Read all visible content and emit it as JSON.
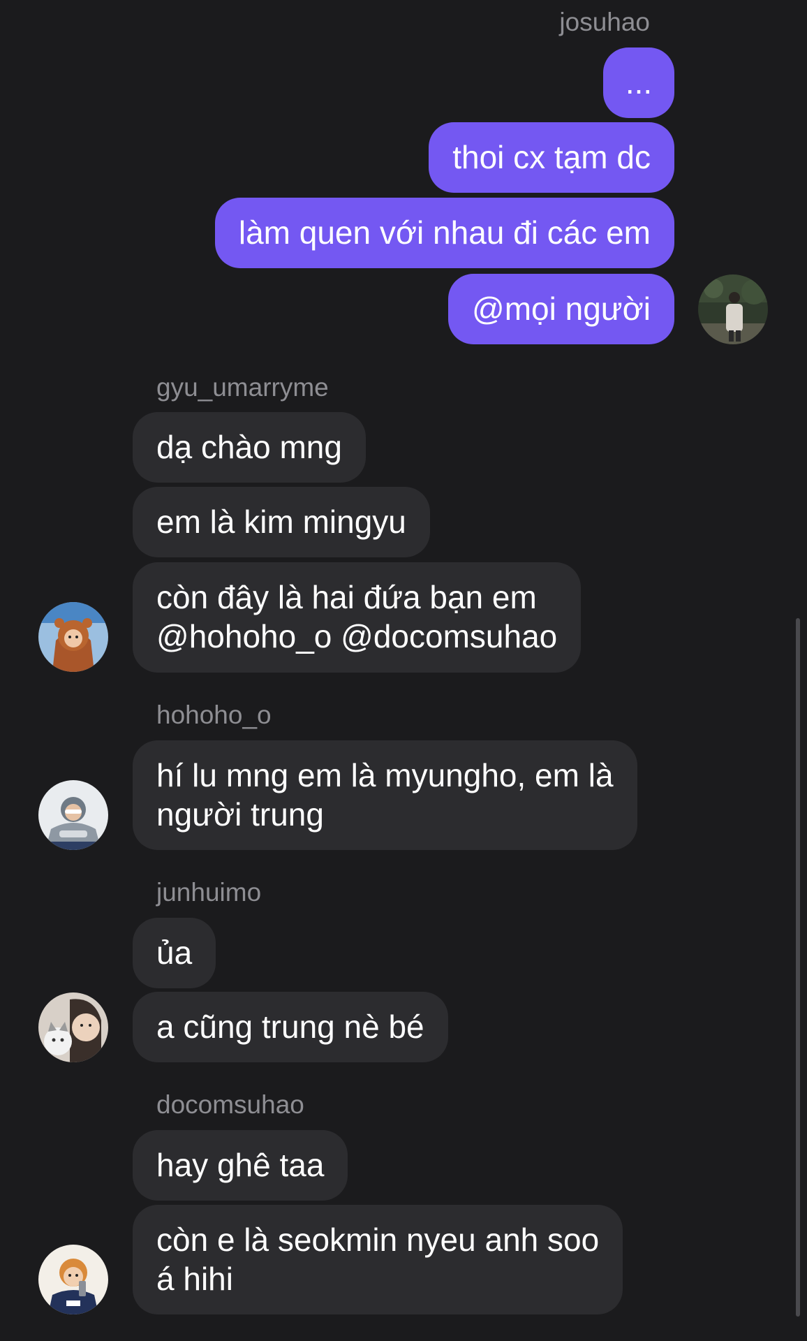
{
  "outgoing": {
    "sender": "josuhao",
    "messages": [
      "...",
      "thoi cx tạm dc",
      "làm quen với nhau đi các em",
      "@mọi người"
    ]
  },
  "groups": [
    {
      "sender": "gyu_umarryme",
      "messages": [
        "dạ chào mng",
        "em là kim mingyu",
        "còn đây là hai đứa bạn em\n@hohoho_o @docomsuhao"
      ]
    },
    {
      "sender": "hohoho_o",
      "messages": [
        "hí lu mng em là myungho, em là\nngười trung"
      ]
    },
    {
      "sender": "junhuimo",
      "messages": [
        "ủa",
        "a cũng trung nè bé"
      ]
    },
    {
      "sender": "docomsuhao",
      "messages": [
        "hay ghê taa",
        "còn e là seokmin nyeu anh soo\ná hihi"
      ]
    }
  ],
  "colors": {
    "background": "#1b1b1d",
    "outgoing_bubble": "#7458f2",
    "incoming_bubble": "#2c2c2f",
    "sender_text": "#8e8e93"
  }
}
